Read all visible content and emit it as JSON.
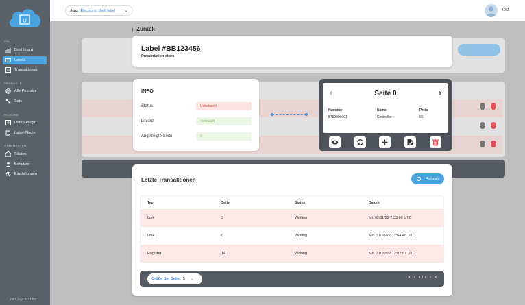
{
  "sidebar": {
    "sections": [
      "ESL",
      "Produkte",
      "Plugins",
      "Stammdaten"
    ],
    "items": [
      {
        "label": "Dashboard",
        "icon": "chart-icon"
      },
      {
        "label": "Labels",
        "icon": "label-icon",
        "active": true
      },
      {
        "label": "Transaktionen",
        "icon": "transaction-icon"
      },
      {
        "label": "Alle Produkte",
        "icon": "products-icon"
      },
      {
        "label": "Sets",
        "icon": "sets-icon"
      },
      {
        "label": "Daten-Plugin",
        "icon": "data-plugin-icon"
      },
      {
        "label": "Label-Plugin",
        "icon": "label-plugin-icon"
      },
      {
        "label": "Filialen",
        "icon": "store-icon"
      },
      {
        "label": "Benutzer",
        "icon": "users-icon"
      },
      {
        "label": "Einstellungen",
        "icon": "gear-icon"
      }
    ],
    "version": "2.6.4.4-go-8151351",
    "logo_letter": "U"
  },
  "topbar": {
    "app_label": "App:",
    "app_value": "Electronic shelf label",
    "user": "test"
  },
  "back_label": "Zurück",
  "label_card": {
    "title": "Label #BB123456",
    "subtitle": "Presentation store"
  },
  "info": {
    "heading": "INFO",
    "rows": [
      {
        "label": "Status",
        "value": "Unbekannt",
        "tone": "red"
      },
      {
        "label": "Linked",
        "value": "Verknüpft",
        "tone": "green"
      },
      {
        "label": "Angezeigte Seite",
        "value": "0",
        "tone": "green"
      }
    ]
  },
  "device": {
    "page_title": "Seite 0",
    "columns": [
      {
        "header": "Nummer",
        "value": "8750000001"
      },
      {
        "header": "Name",
        "value": "Controller"
      },
      {
        "header": "Preis",
        "value": "95"
      }
    ]
  },
  "transactions": {
    "heading": "Letzte Transaktionen",
    "refresh_label": "Refresh",
    "columns": [
      "Typ",
      "Seite",
      "Status",
      "Datum"
    ],
    "rows": [
      [
        "Link",
        "3",
        "Waiting",
        "Mi. 02/11/22 7:53:09 UTC"
      ],
      [
        "Link",
        "0",
        "Waiting",
        "Mo. 31/10/22 12:04:48 UTC"
      ],
      [
        "Register",
        "14",
        "Waiting",
        "Mo. 31/10/22 12:02:57 UTC"
      ]
    ],
    "page_size_label": "Größe der Seite:",
    "page_size_value": "5",
    "page_info": "1 / 1"
  },
  "colors": {
    "accent": "#4aa3df",
    "sidebar": "#5a6169",
    "danger": "#e0525a"
  }
}
